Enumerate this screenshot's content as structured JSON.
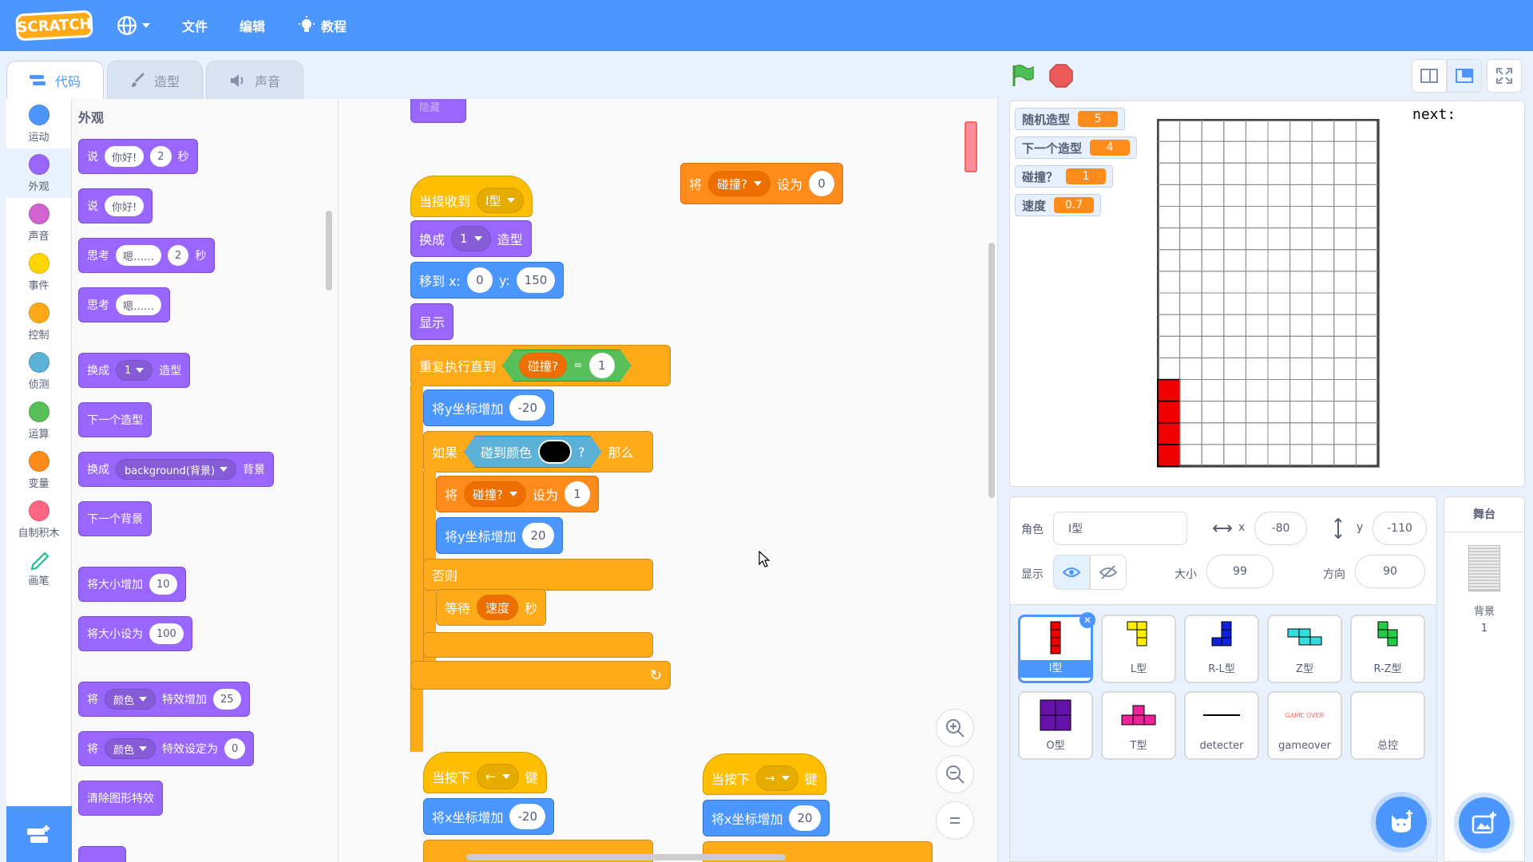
{
  "menu": {
    "language_icon": "globe-icon",
    "file": "文件",
    "edit": "编辑",
    "tutorials": "教程",
    "logo_text": "SCRATCH"
  },
  "tabs": [
    {
      "label": "代码"
    },
    {
      "label": "造型"
    },
    {
      "label": "声音"
    }
  ],
  "categories": [
    {
      "label": "运动",
      "color": "#4c97ff"
    },
    {
      "label": "外观",
      "color": "#9966ff"
    },
    {
      "label": "声音",
      "color": "#cf63cf"
    },
    {
      "label": "事件",
      "color": "#ffd500"
    },
    {
      "label": "控制",
      "color": "#ffab19"
    },
    {
      "label": "侦测",
      "color": "#5cb1d6"
    },
    {
      "label": "运算",
      "color": "#59c059"
    },
    {
      "label": "变量",
      "color": "#ff8c1a"
    },
    {
      "label": "自制积木",
      "color": "#ff6680"
    },
    {
      "label": "画笔",
      "color": "#0fbd8c"
    }
  ],
  "palette": {
    "title": "外观",
    "say_secs": {
      "say": "说",
      "msg": "你好!",
      "secs": "2",
      "unit": "秒"
    },
    "say": {
      "say": "说",
      "msg": "你好!"
    },
    "think_secs": {
      "think": "思考",
      "msg": "嗯……",
      "secs": "2",
      "unit": "秒"
    },
    "think": {
      "think": "思考",
      "msg": "嗯……"
    },
    "switch_costume": {
      "a": "换成",
      "val": "1",
      "b": "造型"
    },
    "next_costume": "下一个造型",
    "switch_backdrop": {
      "a": "换成",
      "val": "background(背景)",
      "b": "背景"
    },
    "next_backdrop": "下一个背景",
    "change_size": {
      "a": "将大小增加",
      "val": "10"
    },
    "set_size": {
      "a": "将大小设为",
      "val": "100"
    },
    "change_effect": {
      "a": "将",
      "effect": "颜色",
      "b": "特效增加",
      "val": "25"
    },
    "set_effect": {
      "a": "将",
      "effect": "颜色",
      "b": "特效设定为",
      "val": "0"
    },
    "clear_effects": "清除图形特效"
  },
  "script": {
    "top_partial": "隐藏",
    "hat": {
      "a": "当接收到",
      "msg": "I型"
    },
    "switch": {
      "a": "换成",
      "val": "1",
      "b": "造型"
    },
    "goto": {
      "a": "移到 x:",
      "x": "0",
      "b": "y:",
      "y": "150"
    },
    "show": "显示",
    "repeat_until": {
      "a": "重复执行直到",
      "var": "碰撞?",
      "op": "=",
      "val": "1"
    },
    "change_y": {
      "a": "将y坐标增加",
      "val": "-20"
    },
    "if": {
      "a": "如果",
      "sense": "碰到颜色",
      "q": "?",
      "then": "那么"
    },
    "set_collide": {
      "a": "将",
      "var": "碰撞?",
      "b": "设为",
      "val": "1"
    },
    "change_y2": {
      "a": "将y坐标增加",
      "val": "20"
    },
    "else": "否则",
    "wait": {
      "a": "等待",
      "var": "速度",
      "b": "秒"
    },
    "set_floating": {
      "a": "将",
      "var": "碰撞?",
      "b": "设为",
      "val": "0"
    },
    "key_left": {
      "a": "当按下",
      "key": "←",
      "b": "键"
    },
    "change_x_left": {
      "a": "将x坐标增加",
      "val": "-20"
    },
    "key_right": {
      "a": "当按下",
      "key": "→",
      "b": "键"
    },
    "change_x_right": {
      "a": "将x坐标增加",
      "val": "20"
    }
  },
  "stage": {
    "monitors": [
      {
        "label": "随机造型",
        "value": "5"
      },
      {
        "label": "下一个造型",
        "value": "4"
      },
      {
        "label": "碰撞？",
        "value": "1"
      },
      {
        "label": "速度",
        "value": "0.7"
      }
    ],
    "next_label": "next:",
    "grid_cols": 10,
    "grid_rows": 16,
    "filled_color": "#ee0000"
  },
  "sprite_info": {
    "sprite_label": "角色",
    "sprite_name": "I型",
    "x_label": "x",
    "x": "-80",
    "y_label": "y",
    "y": "-110",
    "show_label": "显示",
    "size_label": "大小",
    "size": "99",
    "dir_label": "方向",
    "dir": "90"
  },
  "sprites": [
    {
      "name": "I型",
      "color": "#ee0000"
    },
    {
      "name": "L型",
      "color": "#ffee00"
    },
    {
      "name": "R-L型",
      "color": "#1122dd"
    },
    {
      "name": "Z型",
      "color": "#33dddd"
    },
    {
      "name": "R-Z型",
      "color": "#22cc44"
    },
    {
      "name": "O型",
      "color": "#6611aa"
    },
    {
      "name": "T型",
      "color": "#ee2299"
    },
    {
      "name": "detecter",
      "color": "#000000"
    },
    {
      "name": "gameover",
      "color": "#ff6666",
      "thumb_text": "GAME OVER"
    },
    {
      "name": "总控",
      "color": "#ffffff"
    }
  ],
  "stage_panel": {
    "title": "舞台",
    "backdrop_label": "背景",
    "backdrop_count": "1"
  }
}
